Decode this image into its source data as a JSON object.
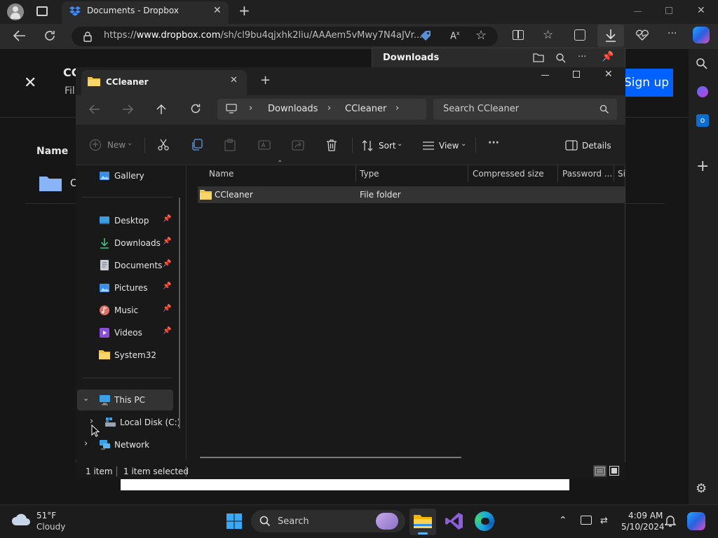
{
  "browser": {
    "tab_title": "Documents - Dropbox",
    "url_prefix": "https://",
    "url_domain": "www.dropbox.com",
    "url_rest": "/sh/cl9bu4qjxhk2liu/AAAem5vMwy7N4aJVr...",
    "new_tab_symbol": "+"
  },
  "downloads": {
    "title": "Downloads"
  },
  "dropbox": {
    "header_fragment": "CC",
    "sub_fragment": "Fil",
    "name_header": "Name",
    "row_fragment": "C",
    "sign_up": "Sign up"
  },
  "explorer": {
    "tab_title": "CCleaner",
    "breadcrumb": [
      "Downloads",
      "CCleaner"
    ],
    "search_placeholder": "Search CCleaner",
    "toolbar": {
      "new_label": "New",
      "sort_label": "Sort",
      "view_label": "View",
      "details_label": "Details"
    },
    "nav": {
      "gallery": "Gallery",
      "quick_access": [
        {
          "label": "Desktop",
          "pinned": true
        },
        {
          "label": "Downloads",
          "pinned": true
        },
        {
          "label": "Documents",
          "pinned": true
        },
        {
          "label": "Pictures",
          "pinned": true
        },
        {
          "label": "Music",
          "pinned": true
        },
        {
          "label": "Videos",
          "pinned": true
        },
        {
          "label": "System32",
          "pinned": false
        }
      ],
      "this_pc": "This PC",
      "local_disk": "Local Disk (C:)",
      "network": "Network"
    },
    "columns": [
      "Name",
      "Type",
      "Compressed size",
      "Password ...",
      "Si"
    ],
    "rows": [
      {
        "name": "CCleaner",
        "type": "File folder"
      }
    ],
    "status": {
      "count": "1 item",
      "selected": "1 item selected"
    }
  },
  "taskbar": {
    "weather_temp": "51°F",
    "weather_desc": "Cloudy",
    "search_label": "Search",
    "time": "4:09 AM",
    "date": "5/10/2024"
  },
  "colors": {
    "accent_blue": "#0061fe",
    "folder_yellow": "#f4c542",
    "selection": "#333333"
  }
}
